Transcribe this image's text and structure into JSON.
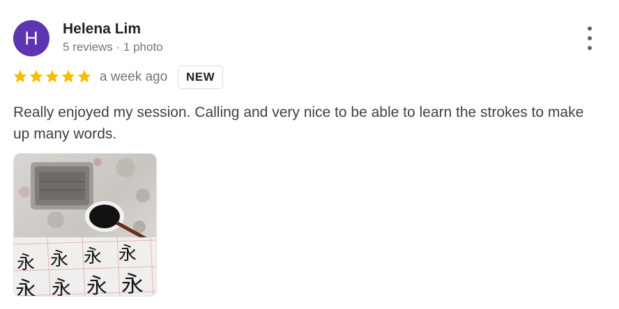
{
  "reviewer": {
    "avatar_letter": "H",
    "avatar_color": "#5e35b1",
    "name": "Helena Lim",
    "meta": "5 reviews · 1 photo"
  },
  "rating": {
    "stars": 5,
    "star_color": "#fbbc04",
    "time": "a week ago",
    "badge": "NEW"
  },
  "review_text": "Really enjoyed my session. Calling and very nice to be able to learn the strokes to make up many words.",
  "menu_icon": "more-vert-icon",
  "photo": {
    "subject": "calligraphy-practice-photo",
    "characters": [
      "永",
      "永",
      "永",
      "永",
      "永",
      "永",
      "永",
      "永"
    ]
  }
}
